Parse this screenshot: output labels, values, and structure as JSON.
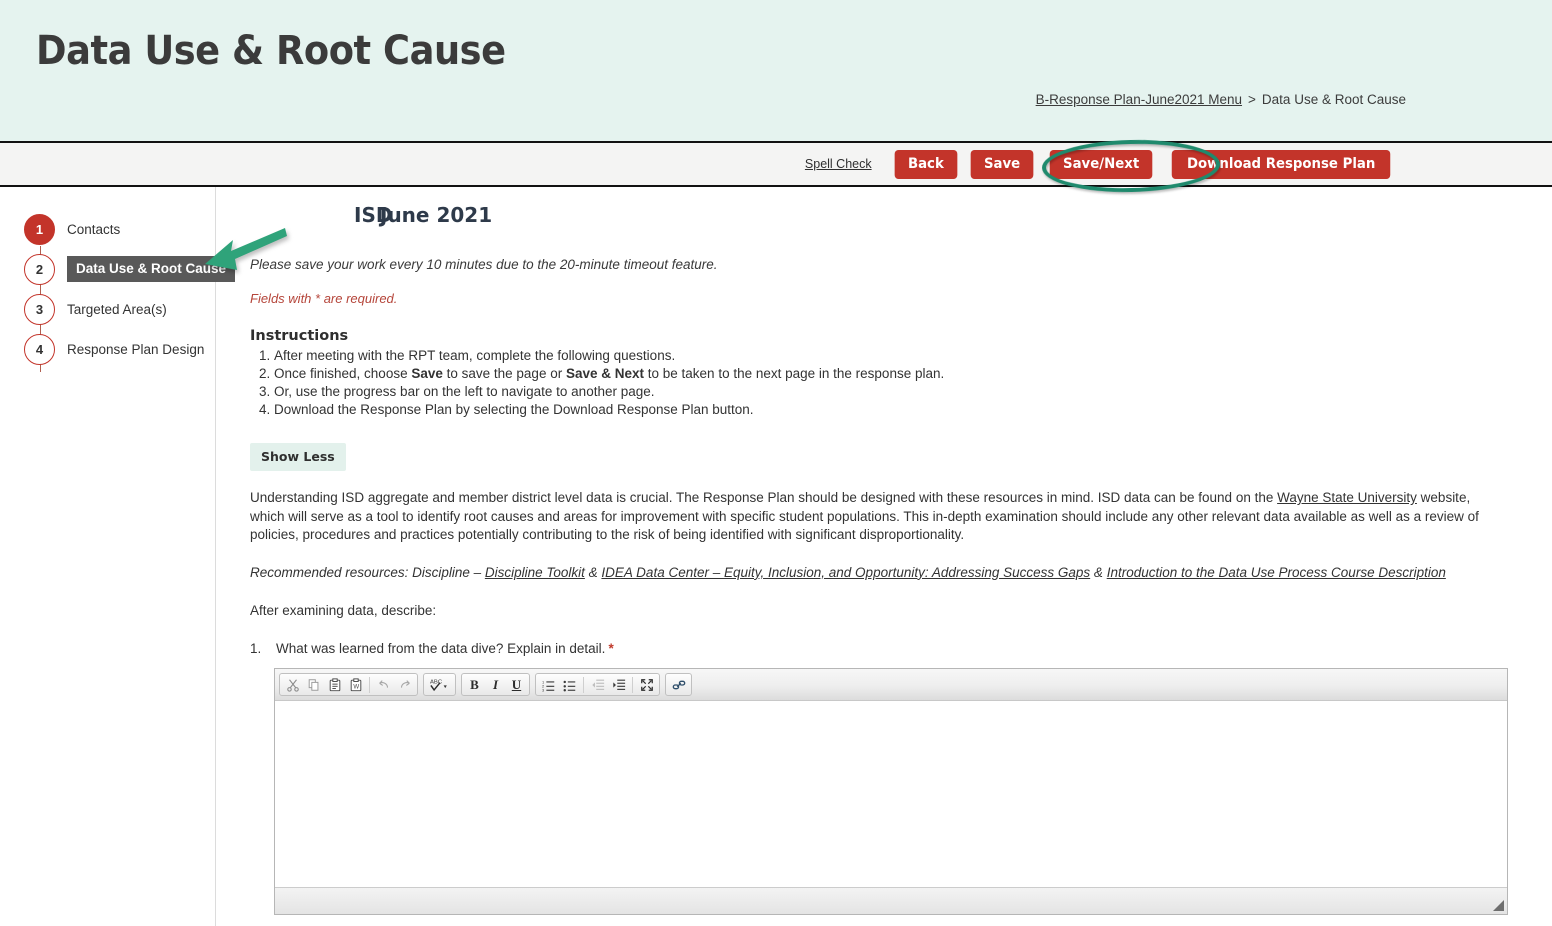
{
  "header": {
    "title": "Data Use & Root Cause",
    "breadcrumb": {
      "parent_link": "B-Response Plan-June2021 Menu",
      "separator": ">",
      "current": "Data Use & Root Cause"
    }
  },
  "toolbar": {
    "spell_check_label": "Spell Check",
    "back_label": "Back",
    "save_label": "Save",
    "save_next_label": "Save/Next",
    "download_label": "Download Response Plan",
    "button_color": "#c3342a"
  },
  "annotations": {
    "ellipse_color": "#1f8a6d",
    "arrow_color": "#2fa37a"
  },
  "sidebar": {
    "steps": [
      {
        "number": "1",
        "label": "Contacts",
        "state": "complete"
      },
      {
        "number": "2",
        "label": "Data Use & Root Cause",
        "state": "current"
      },
      {
        "number": "3",
        "label": "Targeted Area(s)",
        "state": "todo"
      },
      {
        "number": "4",
        "label": "Response Plan Design",
        "state": "todo"
      }
    ]
  },
  "main": {
    "form_heading": {
      "entity": "ISD",
      "period": "June 2021"
    },
    "timeout_note": "Please save your work every 10 minutes due to the 20-minute timeout feature.",
    "required_note": "Fields with * are required.",
    "instructions_title": "Instructions",
    "instructions": [
      "After meeting with the RPT team, complete the following questions.",
      "Once finished, choose Save to save the page or Save & Next to be taken to the next page in the response plan.",
      "Or, use the progress bar on the left to navigate to another page.",
      "Download the Response Plan by selecting the Download Response Plan button."
    ],
    "instruction_2_parts": {
      "pre": "Once finished, choose ",
      "bold1": "Save",
      "mid": " to save the page or ",
      "bold2": "Save & Next",
      "post": " to be taken to the next page in the response plan."
    },
    "show_less_label": "Show Less",
    "description_parts": {
      "p1": "Understanding ISD aggregate and member district level data is crucial. The Response Plan should be designed with these resources in mind. ISD data can be found on the ",
      "link": "Wayne State University",
      "p2": " website, which will serve as a tool to identify root causes and areas for improvement with specific student populations. This in-depth examination should include any other relevant data available as well as a review of policies, procedures and practices potentially contributing to the risk of being identified with significant disproportionality."
    },
    "resources_line": {
      "prefix": "Recommended resources: Discipline – ",
      "link1": "Discipline Toolkit",
      "amp1": " & ",
      "link2": "IDEA Data Center – Equity, Inclusion, and Opportunity: Addressing Success Gaps",
      "amp2": " & ",
      "link3": "Introduction to the Data Use Process Course Description"
    },
    "after_examining": "After examining data, describe:",
    "question": {
      "number": "1.",
      "text": "What was learned from the data dive? Explain in detail.",
      "required_marker": "*"
    }
  },
  "editor": {
    "toolbar_groups": [
      {
        "buttons": [
          "cut-icon",
          "copy-icon",
          "paste-icon",
          "paste-from-word-icon",
          "separator",
          "undo-icon",
          "redo-icon"
        ]
      },
      {
        "buttons": [
          "spell-check-icon",
          "dropdown-arrow-icon"
        ]
      },
      {
        "buttons": [
          "bold-icon",
          "italic-icon",
          "underline-icon"
        ]
      },
      {
        "buttons": [
          "numbered-list-icon",
          "bulleted-list-icon",
          "separator",
          "decrease-indent-icon",
          "increase-indent-icon",
          "separator",
          "maximize-icon"
        ]
      },
      {
        "buttons": [
          "link-icon"
        ]
      }
    ],
    "bold_label": "B",
    "italic_label": "I",
    "underline_label": "U",
    "spell_label": "ABC",
    "content": ""
  }
}
